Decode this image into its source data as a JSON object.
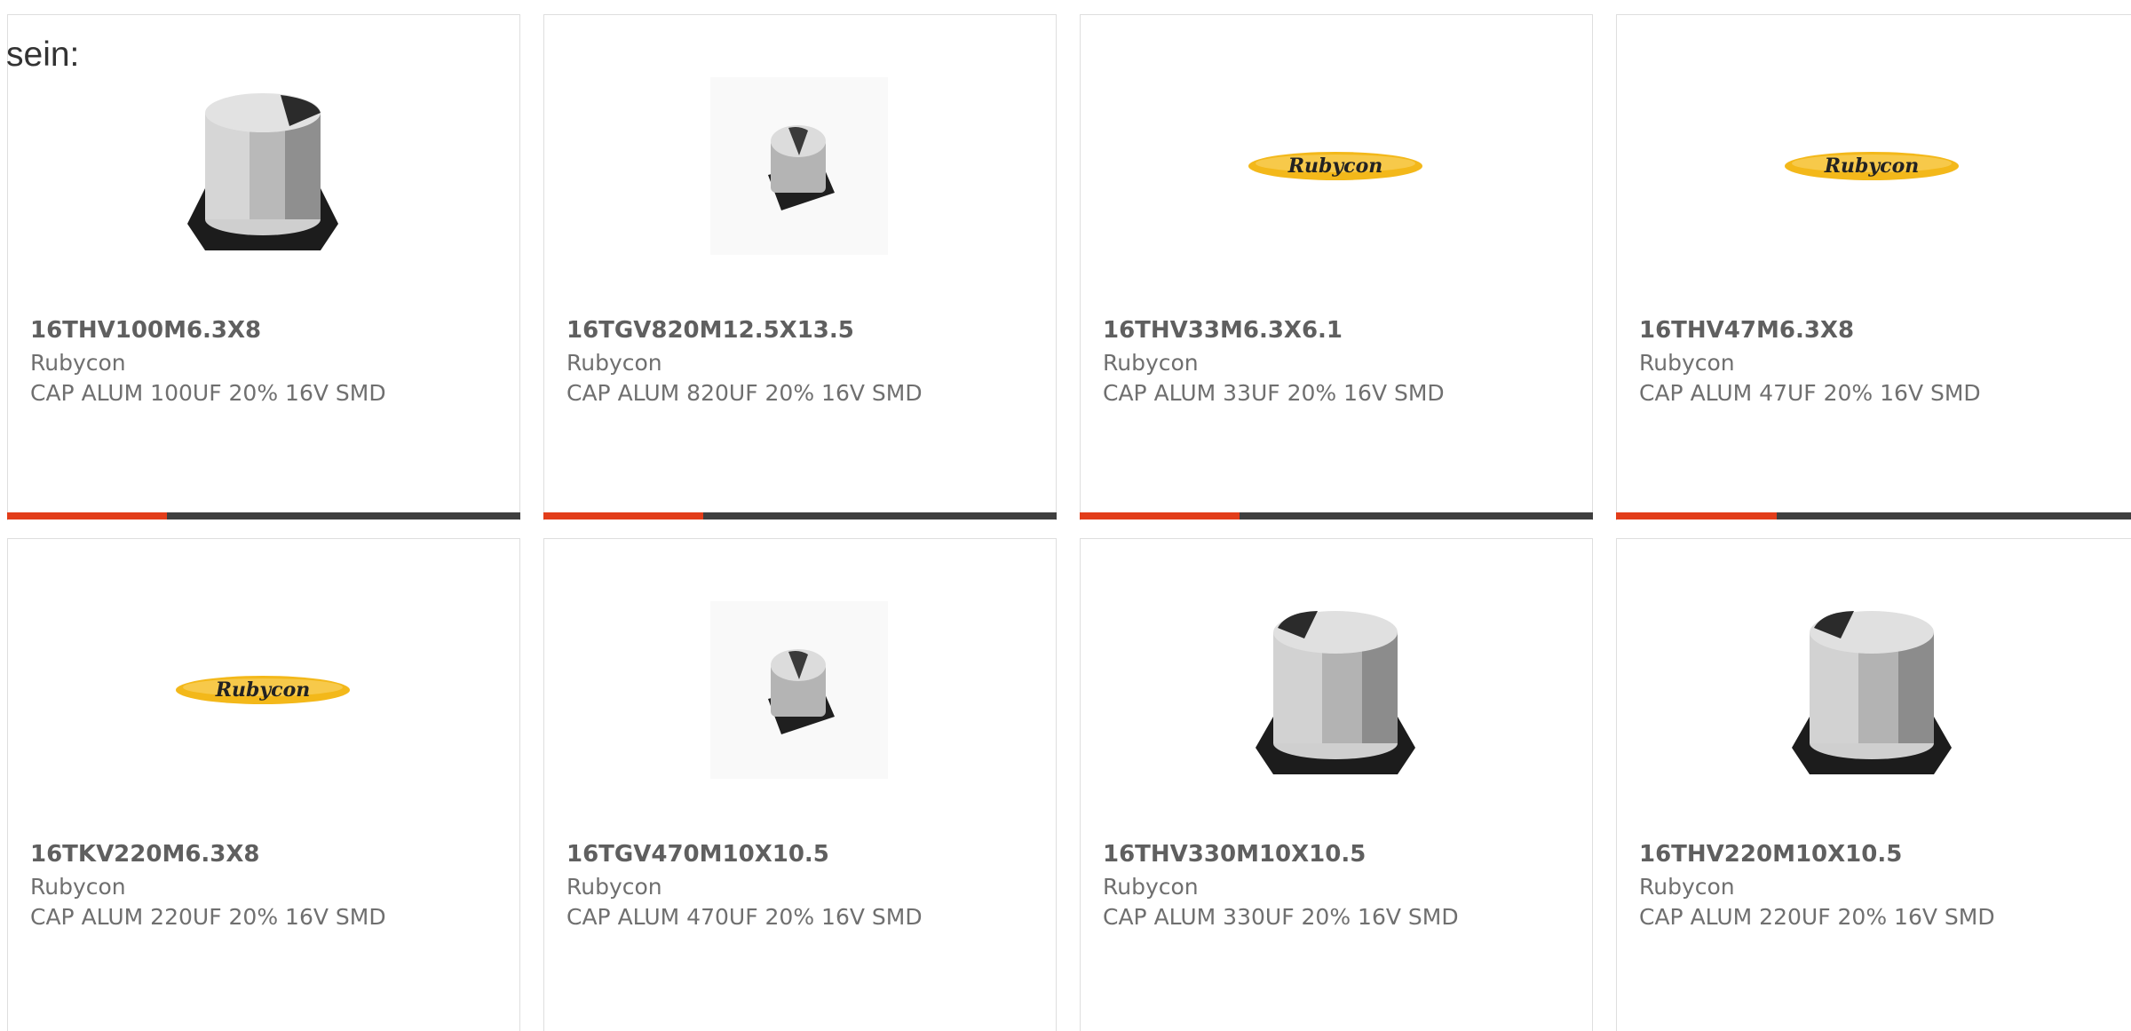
{
  "intro_text": "sein:",
  "colors": {
    "accent": "#e23d1a",
    "bar": "#3f3f3f",
    "border": "#dedede",
    "brand_logo": "#f3b81a"
  },
  "products": [
    {
      "part": "16THV100M6.3X8",
      "manufacturer": "Rubycon",
      "description": "CAP ALUM 100UF 20% 16V SMD",
      "image": "capacitor-large-icon",
      "progress": 0.31
    },
    {
      "part": "16TGV820M12.5X13.5",
      "manufacturer": "Rubycon",
      "description": "CAP ALUM 820UF 20% 16V SMD",
      "image": "capacitor-small-icon",
      "progress": 0.31
    },
    {
      "part": "16THV33M6.3X6.1",
      "manufacturer": "Rubycon",
      "description": "CAP ALUM 33UF 20% 16V SMD",
      "image": "rubycon-logo",
      "logo_text": "Rubycon",
      "progress": 0.31
    },
    {
      "part": "16THV47M6.3X8",
      "manufacturer": "Rubycon",
      "description": "CAP ALUM 47UF 20% 16V SMD",
      "image": "rubycon-logo",
      "logo_text": "Rubycon",
      "progress": 0.31
    },
    {
      "part": "16TKV220M6.3X8",
      "manufacturer": "Rubycon",
      "description": "CAP ALUM 220UF 20% 16V SMD",
      "image": "rubycon-logo",
      "logo_text": "Rubycon"
    },
    {
      "part": "16TGV470M10X10.5",
      "manufacturer": "Rubycon",
      "description": "CAP ALUM 470UF 20% 16V SMD",
      "image": "capacitor-small-icon"
    },
    {
      "part": "16THV330M10X10.5",
      "manufacturer": "Rubycon",
      "description": "CAP ALUM 330UF 20% 16V SMD",
      "image": "capacitor-large-icon"
    },
    {
      "part": "16THV220M10X10.5",
      "manufacturer": "Rubycon",
      "description": "CAP ALUM 220UF 20% 16V SMD",
      "image": "capacitor-large-icon"
    }
  ]
}
